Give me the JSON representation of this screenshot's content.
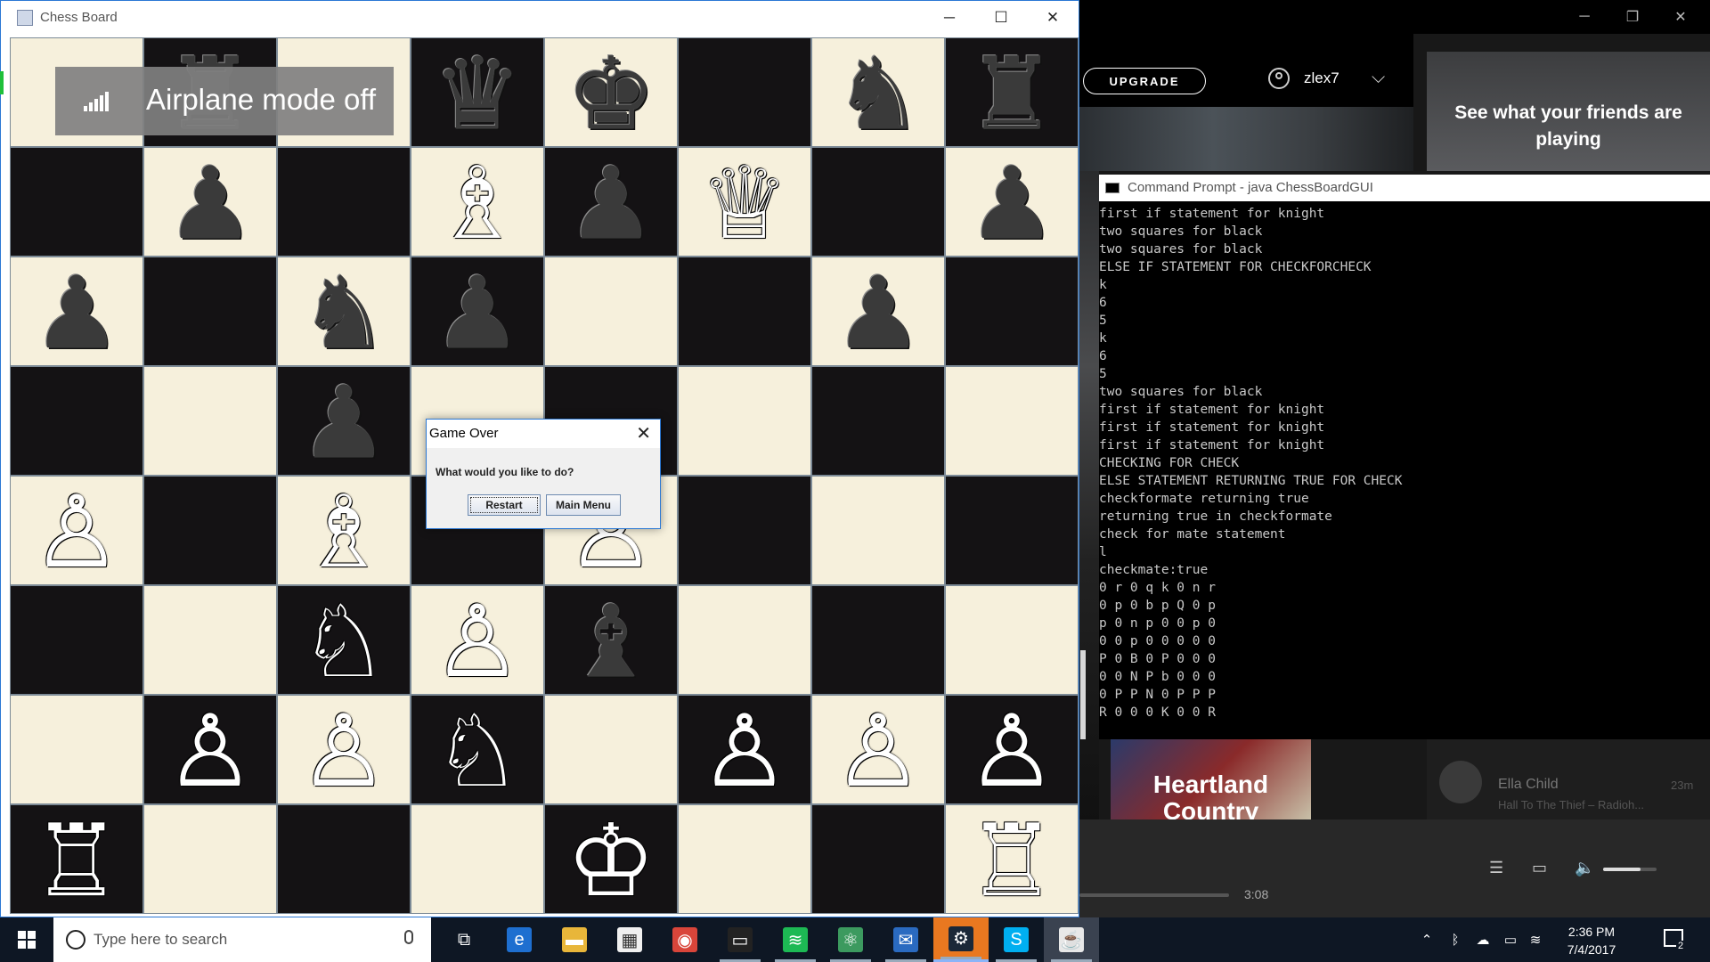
{
  "chess_window": {
    "title": "Chess Board",
    "buttons": {
      "minimize": "─",
      "maximize": "☐",
      "close": "✕"
    }
  },
  "board": {
    "rows": [
      [
        {
          "p": "",
          "c": ""
        },
        {
          "p": "♜",
          "c": "b"
        },
        {
          "p": "",
          "c": ""
        },
        {
          "p": "♛",
          "c": "b"
        },
        {
          "p": "♚",
          "c": "b"
        },
        {
          "p": "",
          "c": ""
        },
        {
          "p": "♞",
          "c": "b"
        },
        {
          "p": "♜",
          "c": "b"
        }
      ],
      [
        {
          "p": "",
          "c": ""
        },
        {
          "p": "♟",
          "c": "b"
        },
        {
          "p": "",
          "c": ""
        },
        {
          "p": "♗",
          "c": "w"
        },
        {
          "p": "♟",
          "c": "b"
        },
        {
          "p": "♕",
          "c": "w"
        },
        {
          "p": "",
          "c": ""
        },
        {
          "p": "♟",
          "c": "b"
        }
      ],
      [
        {
          "p": "♟",
          "c": "b"
        },
        {
          "p": "",
          "c": ""
        },
        {
          "p": "♞",
          "c": "b"
        },
        {
          "p": "♟",
          "c": "b"
        },
        {
          "p": "",
          "c": ""
        },
        {
          "p": "",
          "c": ""
        },
        {
          "p": "♟",
          "c": "b"
        },
        {
          "p": "",
          "c": ""
        }
      ],
      [
        {
          "p": "",
          "c": ""
        },
        {
          "p": "",
          "c": ""
        },
        {
          "p": "♟",
          "c": "b"
        },
        {
          "p": "",
          "c": ""
        },
        {
          "p": "",
          "c": ""
        },
        {
          "p": "",
          "c": ""
        },
        {
          "p": "",
          "c": ""
        },
        {
          "p": "",
          "c": ""
        }
      ],
      [
        {
          "p": "♙",
          "c": "w"
        },
        {
          "p": "",
          "c": ""
        },
        {
          "p": "♗",
          "c": "w"
        },
        {
          "p": "",
          "c": ""
        },
        {
          "p": "♙",
          "c": "w"
        },
        {
          "p": "",
          "c": ""
        },
        {
          "p": "",
          "c": ""
        },
        {
          "p": "",
          "c": ""
        }
      ],
      [
        {
          "p": "",
          "c": ""
        },
        {
          "p": "",
          "c": ""
        },
        {
          "p": "♘",
          "c": "w"
        },
        {
          "p": "♙",
          "c": "w"
        },
        {
          "p": "♝",
          "c": "b"
        },
        {
          "p": "",
          "c": ""
        },
        {
          "p": "",
          "c": ""
        },
        {
          "p": "",
          "c": ""
        }
      ],
      [
        {
          "p": "",
          "c": ""
        },
        {
          "p": "♙",
          "c": "w"
        },
        {
          "p": "♙",
          "c": "w"
        },
        {
          "p": "♘",
          "c": "w"
        },
        {
          "p": "",
          "c": ""
        },
        {
          "p": "♙",
          "c": "w"
        },
        {
          "p": "♙",
          "c": "w"
        },
        {
          "p": "♙",
          "c": "w"
        }
      ],
      [
        {
          "p": "♖",
          "c": "w"
        },
        {
          "p": "",
          "c": ""
        },
        {
          "p": "",
          "c": ""
        },
        {
          "p": "",
          "c": ""
        },
        {
          "p": "♔",
          "c": "w"
        },
        {
          "p": "",
          "c": ""
        },
        {
          "p": "",
          "c": ""
        },
        {
          "p": "♖",
          "c": "w"
        }
      ]
    ],
    "light_color": "#f6f0dc",
    "dark_color": "#141214"
  },
  "toast": {
    "text": "Airplane mode off",
    "icon": "signal-bars-icon"
  },
  "dialog": {
    "title": "Game Over",
    "message": "What would you like to do?",
    "restart_label": "Restart",
    "main_menu_label": "Main Menu",
    "close": "✕"
  },
  "spotify": {
    "upgrade_label": "UPGRADE",
    "username": "zlex7",
    "friends_text": "See what your friends are playing",
    "playlist_title": "Heartland Country",
    "friend": {
      "name": "Ella Child",
      "time": "23m",
      "track": "Hall To The Thief – Radioh..."
    },
    "elapsed": "3:08",
    "window_buttons": {
      "minimize": "─",
      "restore": "❐",
      "close": "✕"
    }
  },
  "cmd": {
    "title": "Command Prompt - java  ChessBoardGUI",
    "lines": [
      "first if statement for knight",
      "two squares for black",
      "two squares for black",
      "ELSE IF STATEMENT FOR CHECKFORCHECK",
      "k",
      "6",
      "5",
      "k",
      "6",
      "5",
      "two squares for black",
      "first if statement for knight",
      "first if statement for knight",
      "first if statement for knight",
      "CHECKING FOR CHECK",
      "ELSE STATEMENT RETURNING TRUE FOR CHECK",
      "checkformate returning true",
      "returning true in checkformate",
      "check for mate statement",
      "l",
      "checkmate:true",
      "0 r 0 q k 0 n r",
      "0 p 0 b p Q 0 p",
      "p 0 n p 0 0 p 0",
      "0 0 p 0 0 0 0 0",
      "P 0 B 0 P 0 0 0",
      "0 0 N P b 0 0 0",
      "0 P P N 0 P P P",
      "R 0 0 0 K 0 0 R"
    ]
  },
  "taskbar": {
    "search_placeholder": "Type here to search",
    "apps": [
      {
        "name": "task-view-icon",
        "glyph": "⧉",
        "bg": "transparent"
      },
      {
        "name": "edge-icon",
        "glyph": "e",
        "bg": "#1e6fd0"
      },
      {
        "name": "file-explorer-icon",
        "glyph": "▬",
        "bg": "#e8b63a"
      },
      {
        "name": "store-icon",
        "glyph": "▦",
        "bg": "#f0f0f0"
      },
      {
        "name": "chrome-icon",
        "glyph": "◉",
        "bg": "#d9453a"
      },
      {
        "name": "terminal-icon",
        "glyph": "▭",
        "bg": "#222"
      },
      {
        "name": "spotify-icon",
        "glyph": "≋",
        "bg": "#1db954"
      },
      {
        "name": "atom-icon",
        "glyph": "⚛",
        "bg": "#3c9a5f"
      },
      {
        "name": "outlook-icon",
        "glyph": "✉",
        "bg": "#2a6ac0"
      },
      {
        "name": "steam-icon",
        "glyph": "⚙",
        "bg": "#1b2838"
      },
      {
        "name": "skype-icon",
        "glyph": "S",
        "bg": "#00aff0"
      },
      {
        "name": "java-icon",
        "glyph": "☕",
        "bg": "#e8e8e8"
      }
    ],
    "time": "2:36 PM",
    "date": "7/4/2017",
    "notification_count": "2"
  }
}
